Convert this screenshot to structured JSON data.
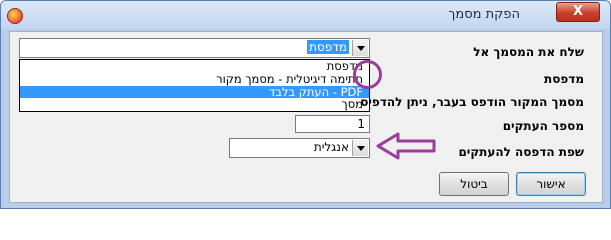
{
  "window": {
    "title": "הפקת מסמך",
    "close_glyph": "X"
  },
  "fields": {
    "send_to": {
      "label": "שלח את המסמך אל",
      "value": "מדפסת"
    },
    "printer": {
      "label": "מדפסת"
    },
    "original_printed": {
      "label": "מסמך המקור הודפס בעבר, ניתן להדפיס"
    },
    "copies": {
      "label": "מספר העתקים",
      "value": "1"
    },
    "language": {
      "label": "שפת הדפסה להעתקים",
      "value": "אנגלית"
    }
  },
  "dropdown": {
    "items": [
      {
        "label": "מדפסת",
        "selected": false
      },
      {
        "label": "חתימה דיגיטלית - מסמך מקור",
        "selected": false
      },
      {
        "label": "PDF - העתק בלבד",
        "selected": true
      },
      {
        "label": "מסך",
        "selected": false
      }
    ]
  },
  "buttons": {
    "ok": "אישור",
    "cancel": "ביטול"
  },
  "colors": {
    "annotation": "#9a3d9a",
    "selection": "#3399ff"
  }
}
